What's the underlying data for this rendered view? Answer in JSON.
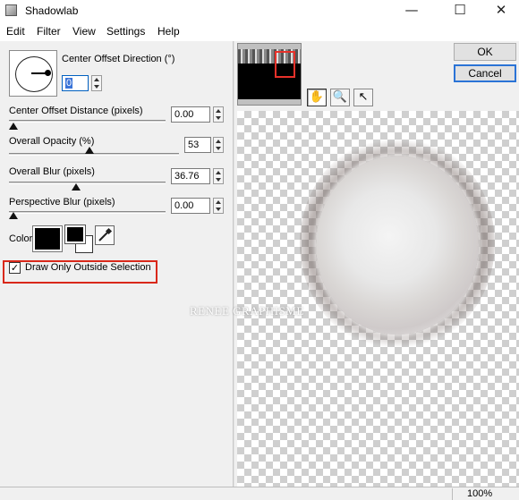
{
  "window": {
    "title": "Shadowlab"
  },
  "menu": [
    "Edit",
    "Filter",
    "View",
    "Settings",
    "Help"
  ],
  "direction": {
    "label": "Center Offset Direction (°)",
    "value": "0"
  },
  "sliders": [
    {
      "label": "Center Offset Distance (pixels)",
      "value": "0.00"
    },
    {
      "label": "Overall Opacity (%)",
      "value": "53"
    },
    {
      "label": "Overall Blur (pixels)",
      "value": "36.76"
    },
    {
      "label": "Perspective Blur (pixels)",
      "value": "0.00"
    }
  ],
  "color": {
    "label": "Color",
    "swatch": "#000000"
  },
  "draw_only_outside": {
    "label": "Draw Only Outside Selection",
    "checked": true
  },
  "buttons": {
    "ok": "OK",
    "cancel": "Cancel"
  },
  "tools": [
    "hand-icon",
    "magnifier-icon",
    "arrow-pointer-icon"
  ],
  "watermark": "RENEE GRAPHISME",
  "status": {
    "zoom": "100%"
  },
  "accent_color": "#d9281a"
}
